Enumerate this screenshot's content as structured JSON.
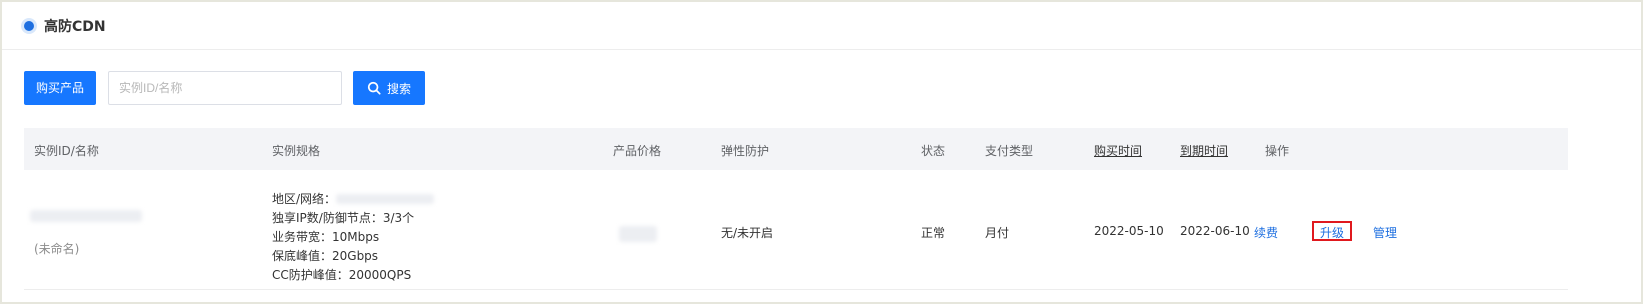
{
  "header": {
    "title": "高防CDN"
  },
  "toolbar": {
    "buy_label": "购买产品",
    "search_placeholder": "实例ID/名称",
    "search_label": "搜索"
  },
  "table": {
    "columns": [
      "实例ID/名称",
      "实例规格",
      "产品价格",
      "弹性防护",
      "状态",
      "支付类型",
      "购买时间",
      "到期时间",
      "操作"
    ],
    "rows": [
      {
        "name": "(未命名)",
        "spec": [
          "地区/网络：",
          "独享IP数/防御节点：3/3个",
          "业务带宽：10Mbps",
          "保底峰值：20Gbps",
          "CC防护峰值：20000QPS"
        ],
        "elastic": "无/未开启",
        "status": "正常",
        "payment": "月付",
        "purchase_time": "2022-05-10",
        "expire_time": "2022-06-10",
        "actions": [
          "续费",
          "升级",
          "管理"
        ]
      }
    ]
  },
  "colors": {
    "accent": "#1677ff",
    "highlight_border": "#e0191e"
  },
  "icons": {
    "search": "search-icon",
    "header_dot": "radio-dot-icon"
  }
}
